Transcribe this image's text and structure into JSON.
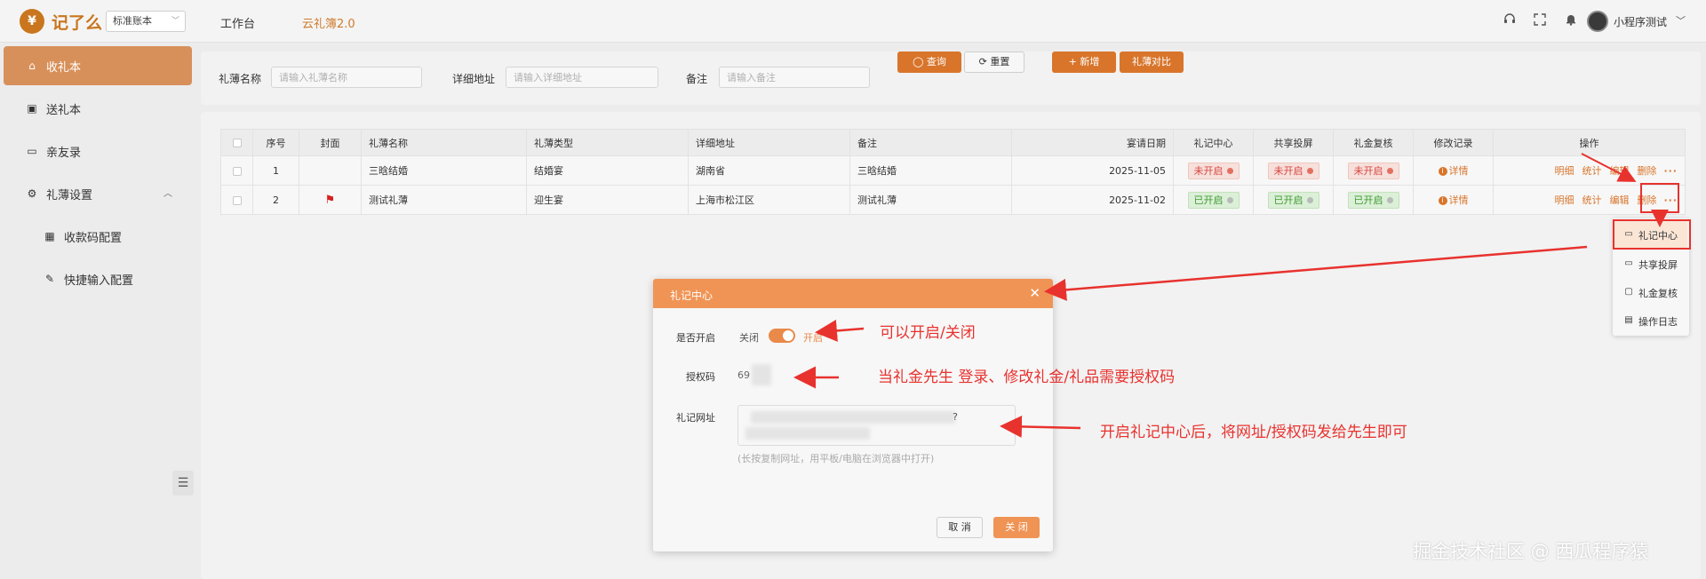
{
  "header": {
    "logo_text": "记了么",
    "logo_glyph": "¥",
    "book_select": "标准账本",
    "nav": [
      "工作台",
      "云礼簿2.0"
    ],
    "user_name": "小程序测试",
    "accent_color": "#d8752b"
  },
  "sidebar": {
    "items": [
      {
        "label": "收礼本",
        "icon": "gift-icon"
      },
      {
        "label": "送礼本",
        "icon": "book-icon"
      },
      {
        "label": "亲友录",
        "icon": "folder-icon"
      },
      {
        "label": "礼薄设置",
        "icon": "gear-icon"
      },
      {
        "label": "收款码配置",
        "icon": "qrcode-icon"
      },
      {
        "label": "快捷输入配置",
        "icon": "edit-icon"
      }
    ]
  },
  "search": {
    "fields": [
      {
        "label": "礼薄名称",
        "placeholder": "请输入礼薄名称"
      },
      {
        "label": "详细地址",
        "placeholder": "请输入详细地址"
      },
      {
        "label": "备注",
        "placeholder": "请输入备注"
      }
    ],
    "query_label": "查询",
    "reset_label": "重置",
    "add_label": "新增",
    "compare_label": "礼薄对比"
  },
  "table": {
    "headers": [
      "序号",
      "封面",
      "礼薄名称",
      "礼薄类型",
      "详细地址",
      "备注",
      "宴请日期",
      "礼记中心",
      "共享投屏",
      "礼金复核",
      "修改记录",
      "操作"
    ],
    "rows": [
      {
        "index": "1",
        "name": "三晗结婚",
        "type": "结婚宴",
        "address": "湖南省",
        "note": "三晗结婚",
        "date": "2025-11-05",
        "center": "未开启",
        "share": "未开启",
        "review": "未开启",
        "record": "详情",
        "status": "off",
        "cover": false
      },
      {
        "index": "2",
        "name": "测试礼薄",
        "type": "迎生宴",
        "address": "上海市松江区",
        "note": "测试礼薄",
        "date": "2025-11-02",
        "center": "已开启",
        "share": "已开启",
        "review": "已开启",
        "record": "详情",
        "status": "on",
        "cover": true
      }
    ],
    "ops": [
      "明细",
      "统计",
      "编辑",
      "删除"
    ],
    "more": "···"
  },
  "dropdown": {
    "items": [
      {
        "label": "礼记中心",
        "icon": "chat-icon"
      },
      {
        "label": "共享投屏",
        "icon": "monitor-icon"
      },
      {
        "label": "礼金复核",
        "icon": "lock-icon"
      },
      {
        "label": "操作日志",
        "icon": "log-icon"
      }
    ]
  },
  "modal": {
    "title": "礼记中心",
    "enable_label": "是否开启",
    "switch_off": "关闭",
    "switch_on": "开启",
    "auth_label": "授权码",
    "auth_value": "69",
    "url_label": "礼记网址",
    "url_visible": "?",
    "url_hint": "(长按复制网址，用平板/电脑在浏览器中打开)",
    "cancel_label": "取 消",
    "close_label": "关 闭"
  },
  "annotations": [
    "可以开启/关闭",
    "当礼金先生 登录、修改礼金/礼品需要授权码",
    "开启礼记中心后，将网址/授权码发给先生即可"
  ],
  "watermark": "掘金技术社区 @ 西瓜程序猿"
}
